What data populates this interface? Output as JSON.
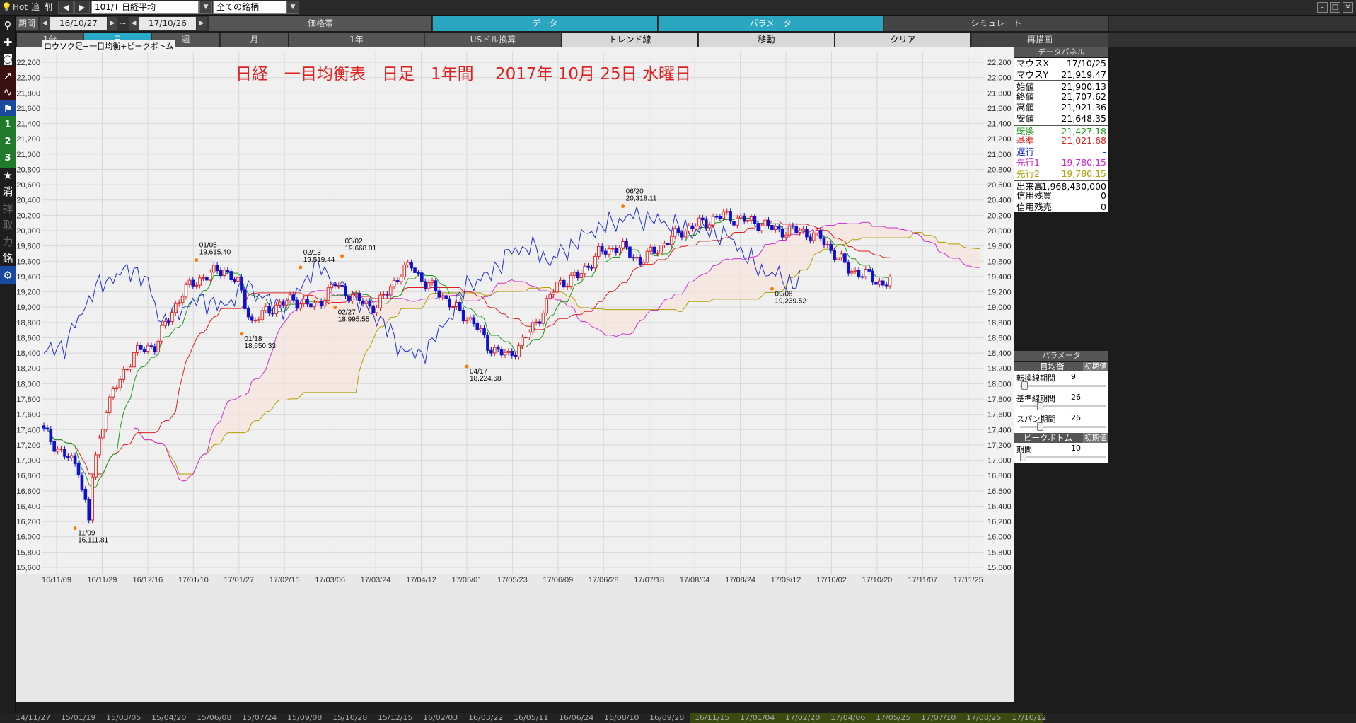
{
  "top": {
    "menu": [
      "Hot",
      "追",
      "削"
    ],
    "symbol": "101/T 日経平均",
    "filter": "全ての銘柄"
  },
  "toolbar": {
    "period_label": "期間",
    "from": "16/10/27",
    "tilde": "~",
    "to": "17/10/26",
    "tabs": [
      "価格帯",
      "データ",
      "パラメータ",
      "シミュレート"
    ]
  },
  "timeframes": [
    "1分",
    "日",
    "週",
    "月",
    "1年",
    "USドル換算",
    "トレンド線",
    "移動",
    "クリア",
    "再描画"
  ],
  "sidebar": {
    "buttons": [
      {
        "icon": "search-icon",
        "glyph": "⚲"
      },
      {
        "icon": "crosshair-icon",
        "glyph": "✚"
      },
      {
        "icon": "camera-icon",
        "glyph": "◙"
      },
      {
        "icon": "line-chart-icon",
        "glyph": "↗"
      },
      {
        "icon": "indicator-chart-icon",
        "glyph": "∿"
      },
      {
        "icon": "flag-icon",
        "glyph": "⚑"
      },
      {
        "label": "1"
      },
      {
        "label": "2"
      },
      {
        "label": "3"
      },
      {
        "icon": "star-icon",
        "glyph": "★"
      },
      {
        "label": "消"
      },
      {
        "label": "詳"
      },
      {
        "label": "取"
      },
      {
        "label": "力"
      },
      {
        "label": "銘"
      },
      {
        "icon": "gear-icon",
        "glyph": "⚙"
      }
    ]
  },
  "chart": {
    "subtitle": "ロウソク足+一目均衡+ピークボトム",
    "title": "日経　一目均衡表　日足　1年間　 2017年 10月 25日 水曜日"
  },
  "chart_data": {
    "type": "candlestick",
    "ylim": [
      15600,
      22200
    ],
    "yticks": [
      22200,
      22000,
      21800,
      21600,
      21400,
      21200,
      21000,
      20800,
      20600,
      20400,
      20200,
      20000,
      19800,
      19600,
      19400,
      19200,
      19000,
      18800,
      18600,
      18400,
      18200,
      18000,
      17800,
      17600,
      17400,
      17200,
      17000,
      16800,
      16600,
      16400,
      16200,
      16000,
      15800,
      15600
    ],
    "xticks": [
      "16/11/09",
      "16/11/29",
      "16/12/16",
      "17/01/10",
      "17/01/27",
      "17/02/15",
      "17/03/06",
      "17/03/24",
      "17/04/12",
      "17/05/01",
      "17/05/23",
      "17/06/09",
      "17/06/28",
      "17/07/18",
      "17/08/04",
      "17/08/24",
      "17/09/12",
      "17/10/02",
      "17/10/20",
      "17/11/07",
      "17/11/25"
    ],
    "annotations": [
      {
        "date": "11/09",
        "value": "16,111.81"
      },
      {
        "date": "01/05",
        "value": "19,615.40"
      },
      {
        "date": "01/18",
        "value": "18,650.33"
      },
      {
        "date": "02/13",
        "value": "19,519.44"
      },
      {
        "date": "02/27",
        "value": "18,995.55"
      },
      {
        "date": "03/02",
        "value": "19,668.01"
      },
      {
        "date": "04/17",
        "value": "18,224.68"
      },
      {
        "date": "06/20",
        "value": "20,318.11"
      },
      {
        "date": "09/08",
        "value": "19,239.52"
      }
    ],
    "colors": {
      "tenkan": "#1a9a1a",
      "kijun": "#e02020",
      "chikou": "#2030d0",
      "senkou1": "#d030d0",
      "senkou2": "#b0a000",
      "up": "#e02020",
      "down": "#1010d0"
    }
  },
  "panel": {
    "data_header": "データパネル",
    "rows": [
      {
        "k": "マウスX",
        "v": "17/10/25",
        "c": "#000"
      },
      {
        "k": "マウスY",
        "v": "21,919.47",
        "c": "#000"
      },
      {
        "k": "始値",
        "v": "21,900.13",
        "c": "#000",
        "sep": true
      },
      {
        "k": "終値",
        "v": "21,707.62",
        "c": "#000"
      },
      {
        "k": "高値",
        "v": "21,921.36",
        "c": "#000"
      },
      {
        "k": "安値",
        "v": "21,648.35",
        "c": "#000"
      },
      {
        "k": "転換",
        "v": "21,427.18",
        "c": "#1a9a1a",
        "sep": true
      },
      {
        "k": "基準",
        "v": "21,021.68",
        "c": "#e02020"
      },
      {
        "k": "遅行",
        "v": "-",
        "c": "#2030d0"
      },
      {
        "k": "先行1",
        "v": "19,780.15",
        "c": "#d020d0"
      },
      {
        "k": "先行2",
        "v": "19,780.15",
        "c": "#b0a000"
      },
      {
        "k": "出来高",
        "v": "1,968,430,000",
        "c": "#000",
        "sep": true
      },
      {
        "k": "信用残買",
        "v": "0",
        "c": "#000"
      },
      {
        "k": "信用残売",
        "v": "0",
        "c": "#000"
      }
    ],
    "param_header": "パラメータ",
    "groups": [
      {
        "title": "一目均衡",
        "reset": "初期値",
        "items": [
          {
            "label": "転換線期間",
            "value": "9",
            "pos": 0.02
          },
          {
            "label": "基準線期間",
            "value": "26",
            "pos": 0.22
          },
          {
            "label": "スパン期間",
            "value": "26",
            "pos": 0.22
          }
        ]
      },
      {
        "title": "ピークボトム",
        "reset": "初期値",
        "items": [
          {
            "label": "期間",
            "value": "10",
            "pos": 0.0
          }
        ]
      }
    ]
  },
  "bottom": {
    "labels": [
      "14/11/27",
      "15/01/19",
      "15/03/05",
      "15/04/20",
      "15/06/08",
      "15/07/24",
      "15/09/08",
      "15/10/28",
      "15/12/15",
      "16/02/03",
      "16/03/22",
      "16/05/11",
      "16/06/24",
      "16/08/10",
      "16/09/28",
      "16/11/15",
      "17/01/04",
      "17/02/20",
      "17/04/06",
      "17/05/25",
      "17/07/10",
      "17/08/25",
      "17/10/12"
    ]
  }
}
